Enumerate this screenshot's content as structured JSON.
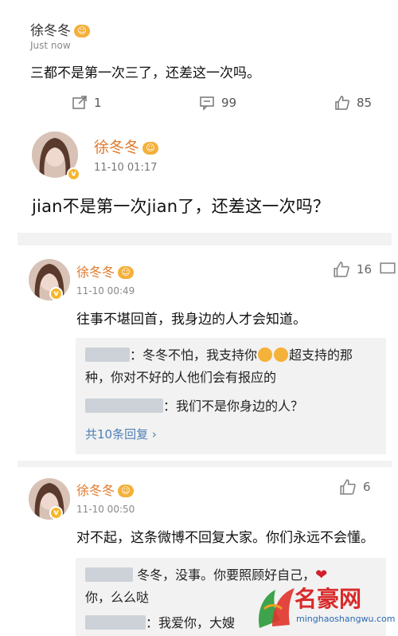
{
  "post1": {
    "name": "徐冬冬",
    "time": "Just now",
    "text": "三都不是第一次三了，还差这一次吗。",
    "actions": {
      "repost": "1",
      "comments": "99",
      "likes": "85"
    }
  },
  "card2": {
    "name": "徐冬冬",
    "time": "11-10 01:17",
    "text": "jian不是第一次jian了，还差这一次吗？"
  },
  "comment1": {
    "name": "徐冬冬",
    "time": "11-10 00:49",
    "text": "往事不堪回首，我身边的人才会知道。",
    "likes": "16",
    "reply1a": "：冬冬不怕，我支持你",
    "reply1b": "超支持的那",
    "reply1c": "种，你对不好的人他们会有报应的",
    "reply2": "：我们不是你身边的人？",
    "more": "共10条回复 ›"
  },
  "comment2": {
    "name": "徐冬冬",
    "time": "11-10 00:50",
    "text": "对不起，这条微博不回复大家。你们永远不会懂。",
    "likes": "6",
    "reply1a": "冬冬，没事。你要照顾好自己，",
    "reply1b": "你，么么哒",
    "reply2": "：我爱你，大嫂"
  },
  "watermark": {
    "text": "名豪网",
    "url": "minghaoshangwu.com"
  },
  "colors": {
    "accent": "#e07a2e",
    "link": "#4f7fb6",
    "vip": "#f4b03a"
  }
}
